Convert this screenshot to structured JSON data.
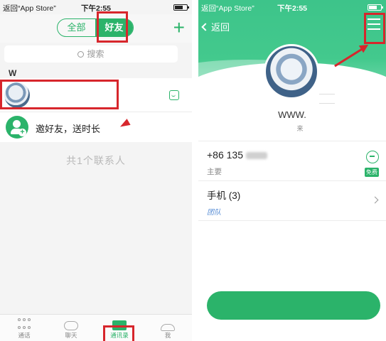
{
  "left": {
    "status": {
      "back_label": "返回“App Store”",
      "time": "下午2:55"
    },
    "header": {
      "tab_all": "全部",
      "tab_friends": "好友",
      "add_icon": "plus-icon"
    },
    "search": {
      "placeholder": "搜索"
    },
    "section_letter": "W",
    "invite_label": "邀好友，送时长",
    "contact_count": "共1个联系人",
    "tabbar": [
      {
        "label": "通话",
        "icon": "dialpad-icon"
      },
      {
        "label": "聊天",
        "icon": "chat-icon"
      },
      {
        "label": "通讯录",
        "icon": "contacts-icon",
        "active": true
      },
      {
        "label": "我",
        "icon": "profile-icon"
      }
    ]
  },
  "right": {
    "status": {
      "back_label": "返回“App Store”",
      "time": "下午2:55"
    },
    "nav": {
      "back_label": "返回",
      "menu_icon": "menu-icon"
    },
    "profile": {
      "name": "WWW.",
      "subtitle": "来"
    },
    "phone": {
      "number": "+86 135",
      "label": "主要",
      "badge": "免费"
    },
    "mobile": {
      "label": "手机 (3)",
      "tag": "团队"
    }
  },
  "colors": {
    "accent": "#2bb36a",
    "annotation_red": "#d7262c"
  }
}
